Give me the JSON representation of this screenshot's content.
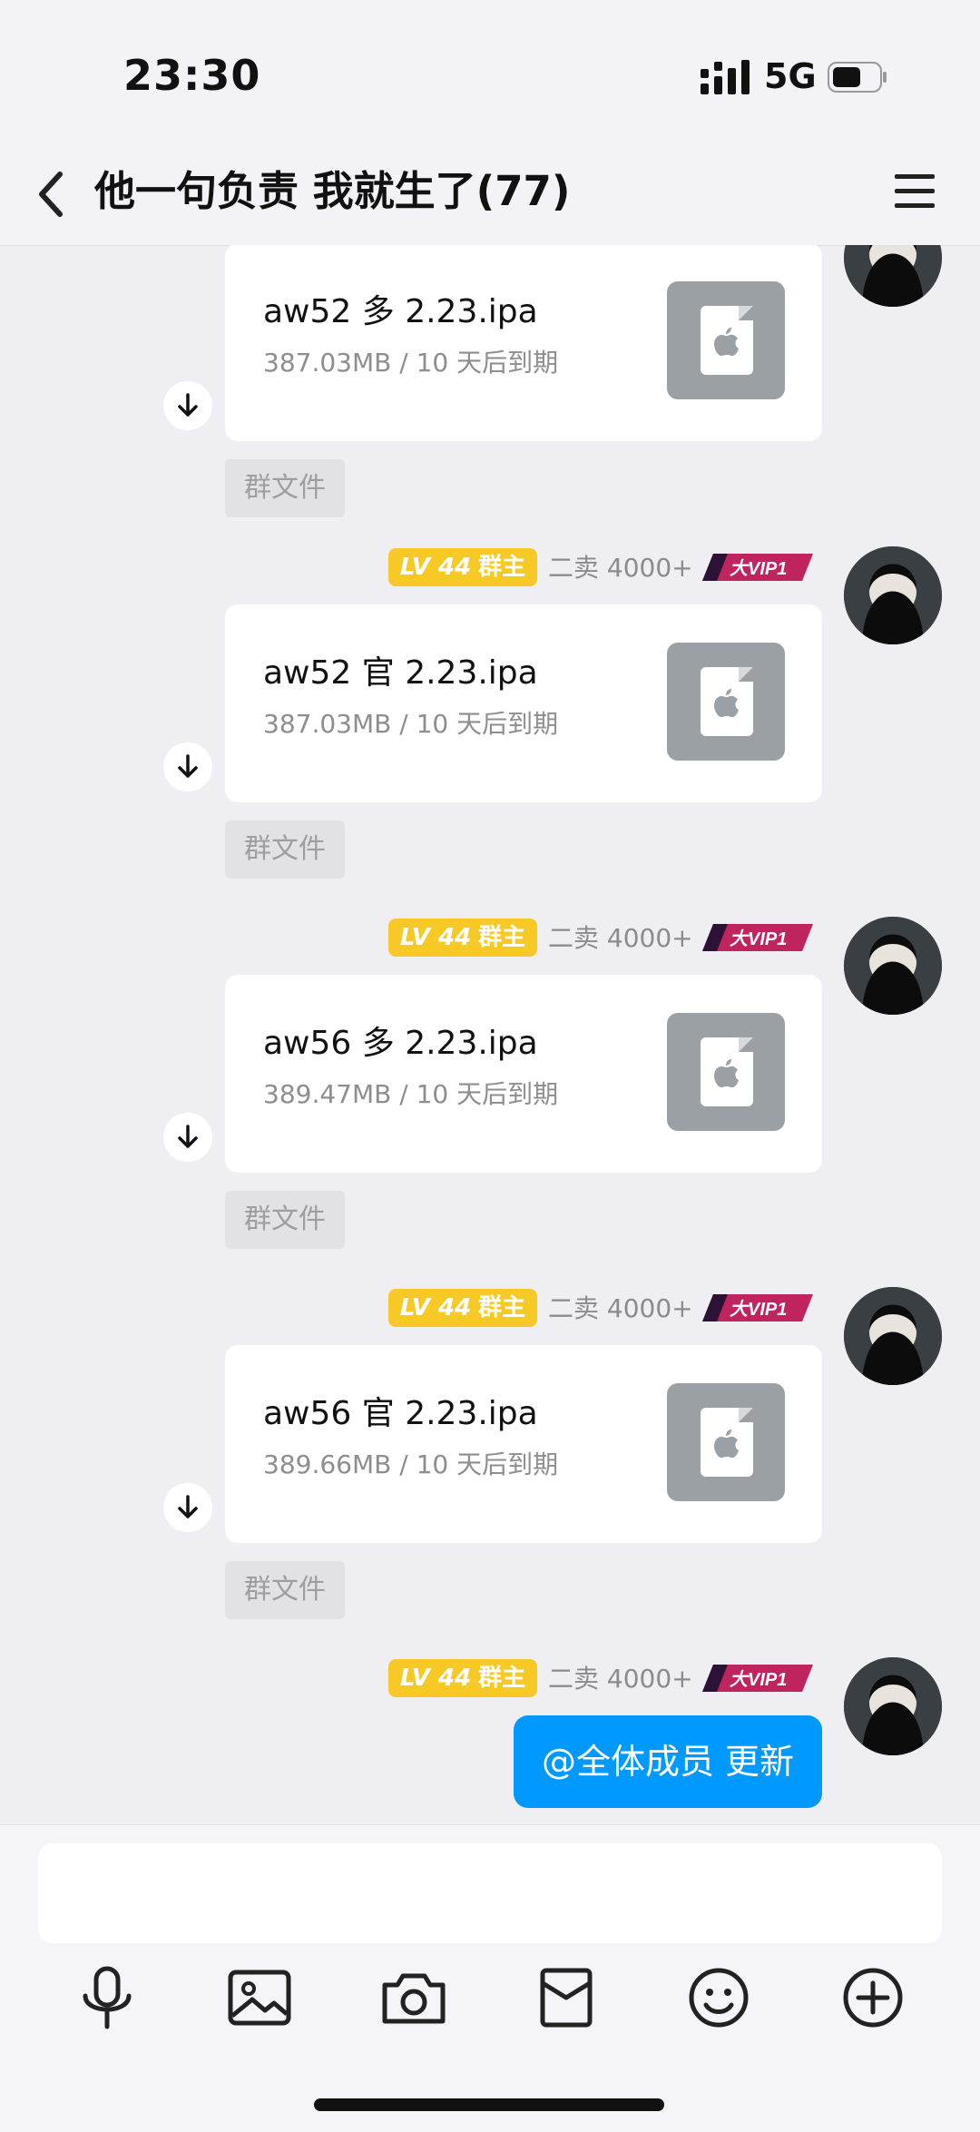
{
  "status_bar": {
    "time": "23:30",
    "network": "5G",
    "icons": [
      "signal-icon",
      "battery-icon"
    ]
  },
  "header": {
    "title": "他一句负责 我就生了(77)",
    "icons": [
      "back-icon",
      "menu-icon"
    ]
  },
  "sender": {
    "level": "LV 44",
    "role": "群主",
    "nickname": "二卖 4000+",
    "vip_badge": "大VIP1"
  },
  "group_file_tag": "群文件",
  "messages": [
    {
      "file_name": "aw52 多 2.23.ipa",
      "meta": "387.03MB / 10 天后到期"
    },
    {
      "file_name": "aw52 官 2.23.ipa",
      "meta": "387.03MB / 10 天后到期"
    },
    {
      "file_name": "aw56 多 2.23.ipa",
      "meta": "389.47MB / 10 天后到期"
    },
    {
      "file_name": "aw56 官 2.23.ipa",
      "meta": "389.66MB / 10 天后到期"
    }
  ],
  "last_message": {
    "text": "@全体成员 更新"
  },
  "toolbar": {
    "icons": [
      "microphone-icon",
      "image-icon",
      "camera-icon",
      "red-packet-icon",
      "emoji-icon",
      "plus-icon"
    ]
  },
  "colors": {
    "background": "#eeeef3",
    "accent": "#0099ff",
    "level_badge": "#f7c926",
    "file_icon_bg": "#9aa0a4"
  }
}
